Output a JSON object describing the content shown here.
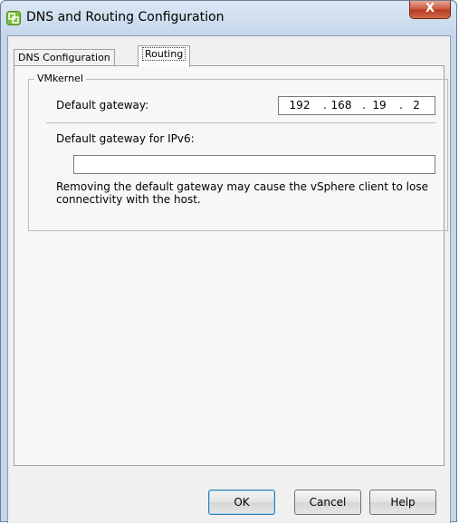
{
  "window": {
    "title": "DNS and Routing Configuration",
    "close_label": "X"
  },
  "tabs": [
    {
      "label": "DNS Configuration",
      "active": false
    },
    {
      "label": "Routing",
      "active": true
    }
  ],
  "group": {
    "legend": "VMkernel",
    "default_gateway_label": "Default gateway:",
    "default_gateway": [
      "192",
      "168",
      "19",
      "2"
    ],
    "ipv6_label": "Default gateway for IPv6:",
    "ipv6_value": "",
    "warning": "Removing the default gateway may cause the vSphere client to lose connectivity with the host."
  },
  "buttons": {
    "ok": "OK",
    "cancel": "Cancel",
    "help": "Help"
  },
  "colors": {
    "title_gradient": "#c5d6ea",
    "close_button": "#c8543b",
    "client_bg": "#f0f0f0"
  }
}
